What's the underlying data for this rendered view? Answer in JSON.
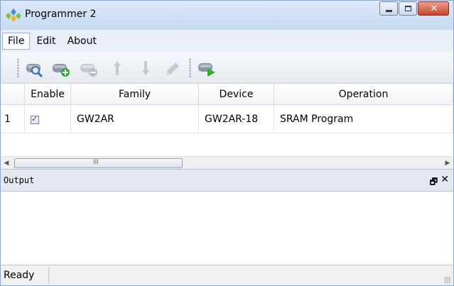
{
  "window": {
    "title": "Programmer 2",
    "icon": "gowin-app-icon",
    "controls": [
      "minimize-icon",
      "maximize-icon",
      "close-icon"
    ]
  },
  "menu": {
    "items": [
      {
        "label": "File",
        "active": true
      },
      {
        "label": "Edit",
        "active": false
      },
      {
        "label": "About",
        "active": false
      }
    ]
  },
  "toolbar": {
    "buttons": [
      {
        "name": "scan-device-icon",
        "enabled": true
      },
      {
        "name": "add-device-icon",
        "enabled": true
      },
      {
        "name": "remove-device-icon",
        "enabled": false
      },
      {
        "name": "move-up-icon",
        "enabled": false
      },
      {
        "name": "move-down-icon",
        "enabled": false
      },
      {
        "name": "edit-icon",
        "enabled": false
      },
      {
        "name": "program-run-icon",
        "enabled": true
      }
    ]
  },
  "table": {
    "headers": {
      "enable": "Enable",
      "family": "Family",
      "device": "Device",
      "operation": "Operation"
    },
    "rows": [
      {
        "index": "1",
        "enabled": true,
        "family": "GW2AR",
        "device": "GW2AR-18",
        "operation": "SRAM Program"
      }
    ]
  },
  "scrollbar": {
    "grip": "III"
  },
  "output": {
    "title": "Output",
    "float_glyph": "🗗",
    "close_glyph": "✕",
    "content": ""
  },
  "status": {
    "text": "Ready"
  },
  "colors": {
    "accent": "#5b9bd5",
    "green": "#3aa537",
    "close": "#c7452c"
  }
}
